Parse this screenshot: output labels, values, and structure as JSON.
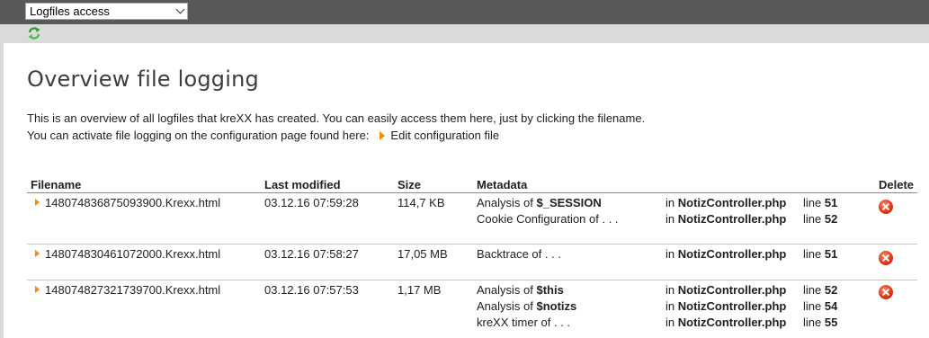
{
  "toolbar": {
    "select_value": "Logfiles access"
  },
  "page": {
    "title": "Overview file logging",
    "intro_line1": "This is an overview of all logfiles that kreXX has created. You can easily access them here, just by clicking the filename.",
    "intro_line2": "You can activate file logging on the configuration page found here:",
    "config_link": "Edit configuration file"
  },
  "table": {
    "headers": {
      "filename": "Filename",
      "modified": "Last modified",
      "size": "Size",
      "metadata": "Metadata",
      "delete": "Delete"
    },
    "rows": [
      {
        "filename": "148074836875093900.Krexx.html",
        "modified": "03.12.16 07:59:28",
        "size": "114,7 KB",
        "meta": [
          {
            "pre": "Analysis of ",
            "var": "$_SESSION",
            "in": "in ",
            "file": "NotizController.php",
            "line": "line ",
            "num": "51"
          },
          {
            "pre": "Cookie Configuration of . . .",
            "var": "",
            "in": "in ",
            "file": "NotizController.php",
            "line": "line ",
            "num": "52"
          }
        ]
      },
      {
        "filename": "148074830461072000.Krexx.html",
        "modified": "03.12.16 07:58:27",
        "size": "17,05 MB",
        "meta": [
          {
            "pre": "Backtrace of . . .",
            "var": "",
            "in": "in ",
            "file": "NotizController.php",
            "line": "line ",
            "num": "51"
          }
        ]
      },
      {
        "filename": "148074827321739700.Krexx.html",
        "modified": "03.12.16 07:57:53",
        "size": "1,17 MB",
        "meta": [
          {
            "pre": "Analysis of ",
            "var": "$this",
            "in": "in ",
            "file": "NotizController.php",
            "line": "line ",
            "num": "52"
          },
          {
            "pre": "Analysis of ",
            "var": "$notizs",
            "in": "in ",
            "file": "NotizController.php",
            "line": "line ",
            "num": "54"
          },
          {
            "pre": "kreXX timer of . . .",
            "var": "",
            "in": "in ",
            "file": "NotizController.php",
            "line": "line ",
            "num": "55"
          }
        ]
      }
    ]
  },
  "colors": {
    "accent": "#f28c00",
    "topbar": "#585858",
    "docheader": "#dadada",
    "delete": "#e0381a"
  }
}
